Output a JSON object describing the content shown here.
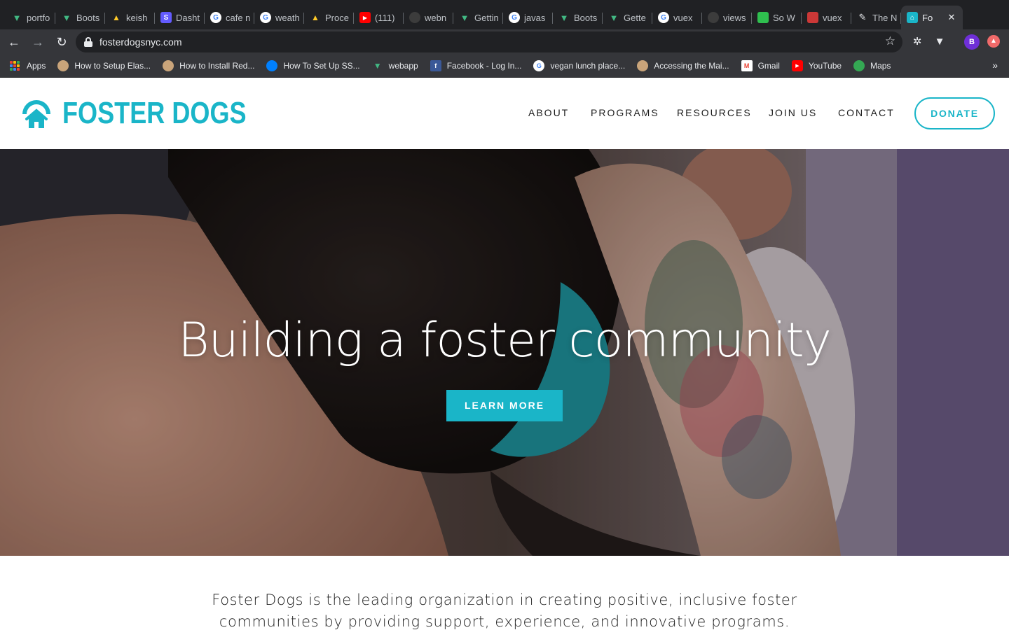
{
  "browser": {
    "tabs": [
      {
        "title": "portfo",
        "icon": "vue-icon",
        "color": "#42b883"
      },
      {
        "title": "Boots",
        "icon": "bootstrap-vue-icon",
        "color": "#41b883"
      },
      {
        "title": "keish",
        "icon": "firebase-icon",
        "color": "#ffca28"
      },
      {
        "title": "Dasht",
        "icon": "stripe-icon",
        "color": "#635bff"
      },
      {
        "title": "cafe n",
        "icon": "google-icon",
        "color": "#ffffff"
      },
      {
        "title": "weath",
        "icon": "google-icon",
        "color": "#ffffff"
      },
      {
        "title": "Proce",
        "icon": "firebase-icon",
        "color": "#ffca28"
      },
      {
        "title": "(111)",
        "icon": "youtube-icon",
        "color": "#ff0000"
      },
      {
        "title": "webn",
        "icon": "github-icon",
        "color": "#3c3c3c"
      },
      {
        "title": "Gettin",
        "icon": "bootstrap-vue-icon",
        "color": "#41b883"
      },
      {
        "title": "javas",
        "icon": "google-icon",
        "color": "#ffffff"
      },
      {
        "title": "Boots",
        "icon": "bootstrap-vue-icon",
        "color": "#41b883"
      },
      {
        "title": "Gette",
        "icon": "vue-icon",
        "color": "#42b883"
      },
      {
        "title": "vuex",
        "icon": "google-icon",
        "color": "#ffffff"
      },
      {
        "title": "views",
        "icon": "github-icon",
        "color": "#3c3c3c"
      },
      {
        "title": "So W",
        "icon": "stairs-icon",
        "color": "#2fbf4f"
      },
      {
        "title": "vuex",
        "icon": "npm-icon",
        "color": "#cb3837"
      },
      {
        "title": "The N",
        "icon": "pen-icon",
        "color": "#e8eaed"
      }
    ],
    "active_tab": {
      "title": "Fo",
      "icon": "foster-dogs-icon"
    },
    "url": "fosterdogsnyc.com",
    "profile_initial": "B",
    "bookmarks": [
      {
        "label": "Apps",
        "icon": "apps-icon"
      },
      {
        "label": "How to Setup Elas...",
        "icon": "site-icon"
      },
      {
        "label": "How to Install Red...",
        "icon": "site-icon"
      },
      {
        "label": "How To Set Up SS...",
        "icon": "digitalocean-icon"
      },
      {
        "label": "webapp",
        "icon": "vue-icon"
      },
      {
        "label": "Facebook - Log In...",
        "icon": "facebook-icon"
      },
      {
        "label": "vegan lunch place...",
        "icon": "google-icon"
      },
      {
        "label": "Accessing the Mai...",
        "icon": "site-icon"
      },
      {
        "label": "Gmail",
        "icon": "gmail-icon"
      },
      {
        "label": "YouTube",
        "icon": "youtube-icon"
      },
      {
        "label": "Maps",
        "icon": "maps-icon"
      }
    ]
  },
  "site": {
    "brand": "FOSTER DOGS",
    "brand_color": "#1ab5c8",
    "nav": [
      "ABOUT",
      "PROGRAMS",
      "RESOURCES",
      "JOIN US",
      "CONTACT"
    ],
    "donate_label": "DONATE",
    "hero": {
      "title": "Building a foster community",
      "button_label": "LEARN MORE"
    },
    "intro_lines": [
      "Foster Dogs is the leading organization in creating positive, inclusive foster",
      "communities by providing support, experience, and innovative programs."
    ]
  }
}
